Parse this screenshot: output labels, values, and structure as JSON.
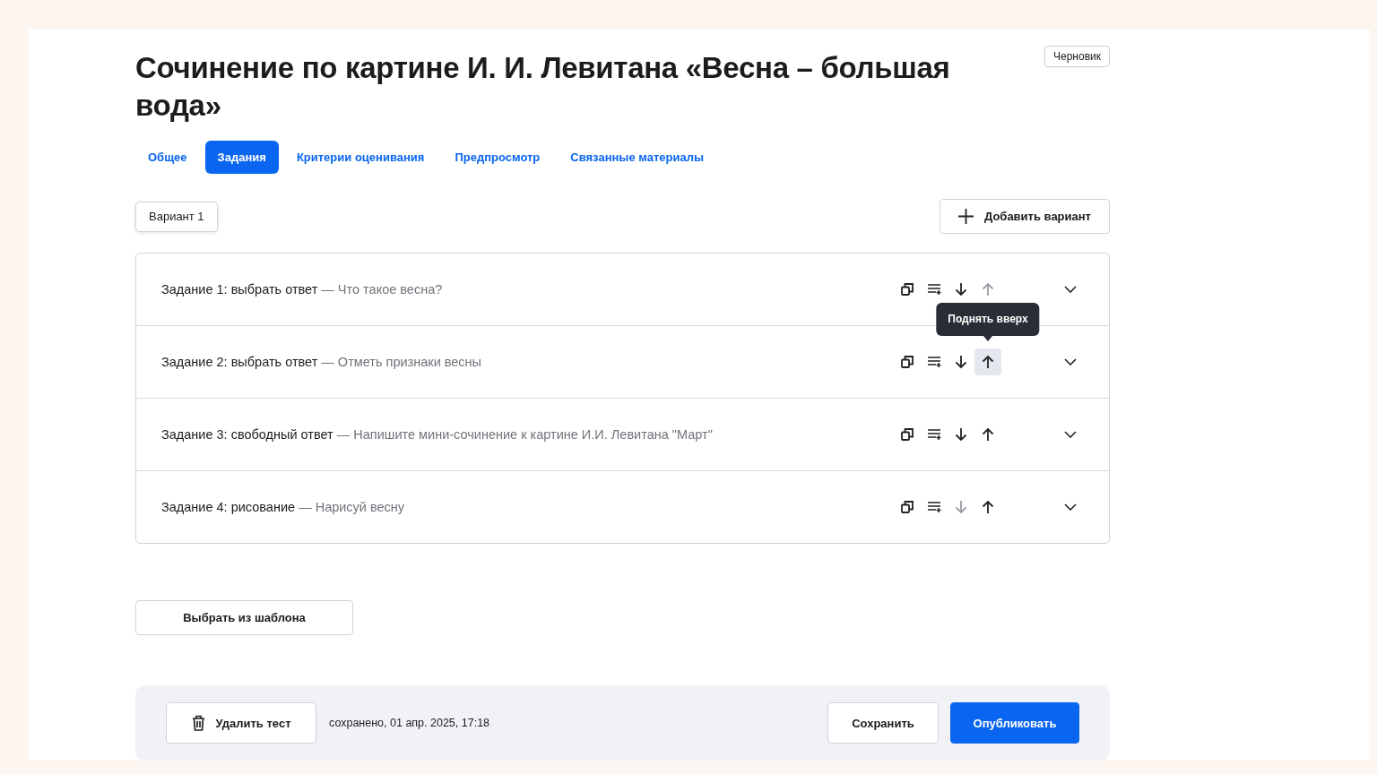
{
  "title": "Сочинение по картине И. И. Левитана «Весна – большая вода»",
  "status_badge": "Черновик",
  "tabs": [
    {
      "label": "Общее",
      "selected": false
    },
    {
      "label": "Задания",
      "selected": true
    },
    {
      "label": "Критерии оценивания",
      "selected": false
    },
    {
      "label": "Предпросмотр",
      "selected": false
    },
    {
      "label": "Связанные материалы",
      "selected": false
    }
  ],
  "variants": [
    {
      "label": "Вариант 1",
      "selected": true
    }
  ],
  "add_variant_button": "Добавить вариант",
  "tasks": [
    {
      "title": "Задание 1: выбрать ответ",
      "description": "— Что такое весна?",
      "move_down_disabled": false,
      "move_up_disabled": true,
      "move_up_hovered": false
    },
    {
      "title": "Задание 2: выбрать ответ",
      "description": "— Отметь признаки весны",
      "move_down_disabled": false,
      "move_up_disabled": false,
      "move_up_hovered": true,
      "tooltip": "Поднять вверх"
    },
    {
      "title": "Задание 3: свободный ответ",
      "description": "— Напишите мини-сочинение к картине И.И. Левитана \"Март\"",
      "move_down_disabled": false,
      "move_up_disabled": false,
      "move_up_hovered": false
    },
    {
      "title": "Задание 4: рисование",
      "description": "— Нарисуй весну",
      "move_down_disabled": true,
      "move_up_disabled": false,
      "move_up_hovered": false
    }
  ],
  "template_button": "Выбрать из шаблона",
  "footer": {
    "delete_button": "Удалить тест",
    "saved_status": "сохранено, 01 апр. 2025, 17:18",
    "save_button": "Сохранить",
    "publish_button": "Опубликовать"
  }
}
